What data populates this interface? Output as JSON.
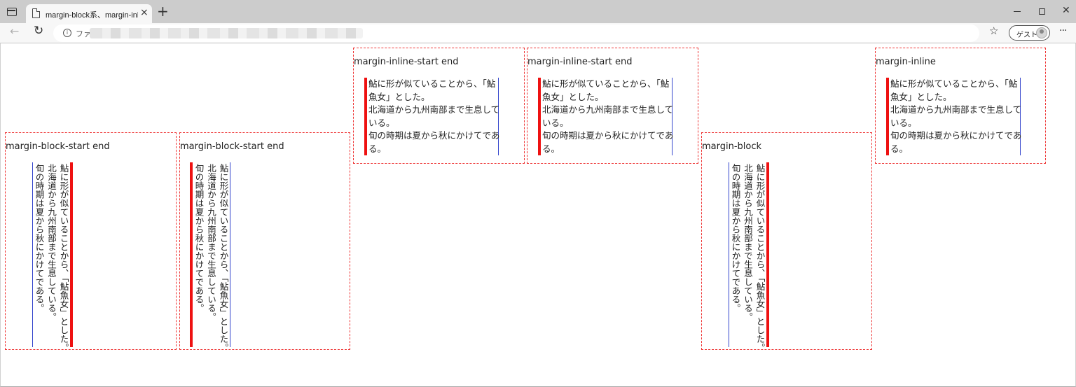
{
  "browser": {
    "tab_title": "margin-block系、margin-inline系",
    "tab_close": "×",
    "new_tab": "+",
    "url_prefix": "ファ",
    "read_aloud": "Aʬ",
    "profile_label": "ゲスト",
    "more": "···"
  },
  "icons": {
    "back": "back-arrow-icon",
    "reload": "reload-icon",
    "info": "info-icon",
    "favorites": "favorites-star-icon",
    "more": "more-dots-icon"
  },
  "colors": {
    "box_border": "#ee3333",
    "start_border": "#ee1111",
    "end_border": "#3344cc"
  },
  "sample": {
    "line1": "鮎に形が似ていることから、「鮎魚女」とした。",
    "line2": "北海道から九州南部まで生息している。",
    "line3": "旬の時期は夏から秋にかけてである。",
    "wrap": {
      "a1": "鮎に形が似ていることから、「鮎",
      "a2": "魚女」とした。",
      "b1": "北海道から九州南部まで生息して",
      "b2": "いる。",
      "c1": "旬の時期は夏から秋にかけてであ",
      "c2": "る。"
    }
  },
  "boxes": {
    "b1": {
      "title": "margin-block-start end"
    },
    "b2": {
      "title": "margin-block-start end"
    },
    "b3": {
      "title": "margin-inline-start end"
    },
    "b4": {
      "title": "margin-inline-start end"
    },
    "b5": {
      "title": "margin-block"
    },
    "b6": {
      "title": "margin-inline"
    }
  }
}
